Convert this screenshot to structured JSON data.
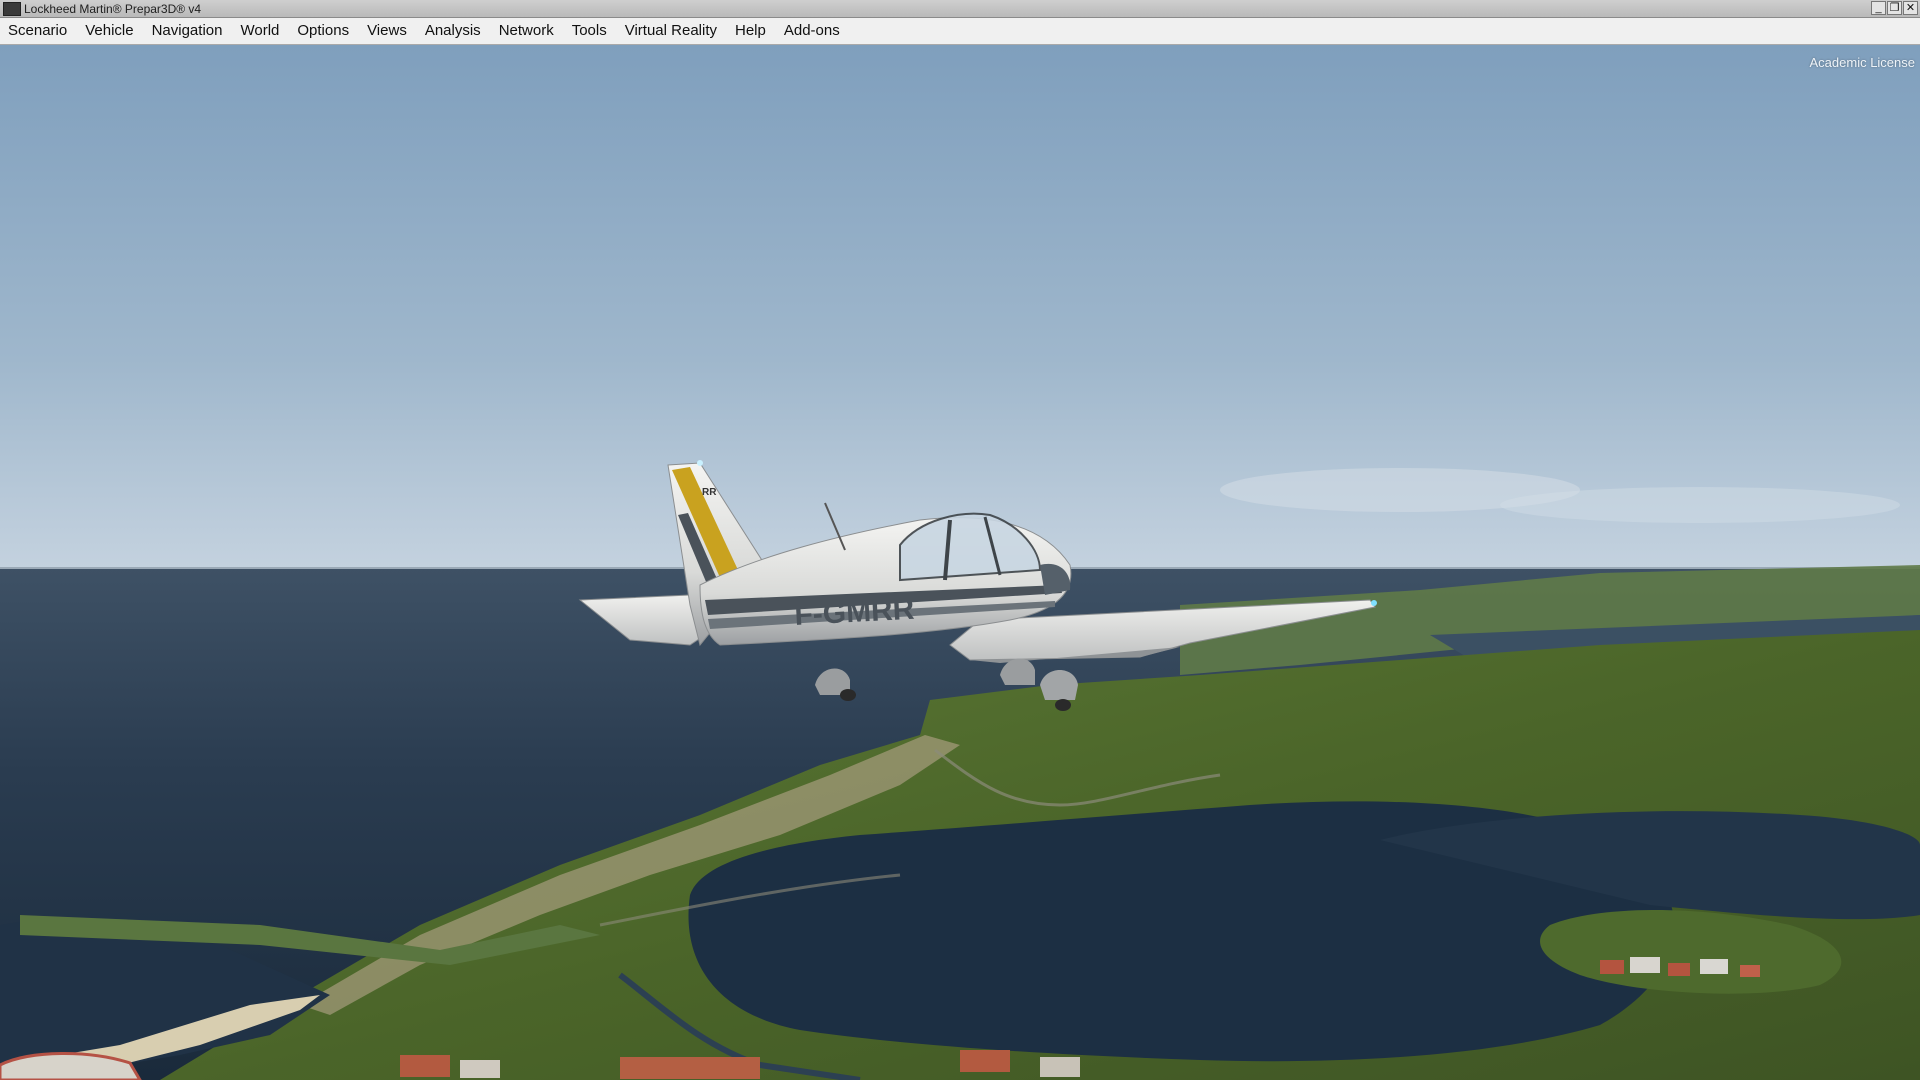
{
  "window": {
    "title": "Lockheed Martin® Prepar3D® v4",
    "controls": [
      "_",
      "❐",
      "✕"
    ]
  },
  "menu": [
    {
      "label": "Scenario"
    },
    {
      "label": "Vehicle"
    },
    {
      "label": "Navigation"
    },
    {
      "label": "World"
    },
    {
      "label": "Options"
    },
    {
      "label": "Views"
    },
    {
      "label": "Analysis"
    },
    {
      "label": "Network"
    },
    {
      "label": "Tools"
    },
    {
      "label": "Virtual Reality"
    },
    {
      "label": "Help"
    },
    {
      "label": "Add-ons"
    }
  ],
  "overlay": {
    "license": "Academic License"
  },
  "aircraft": {
    "registration": "F-GMRR",
    "fin_code": "RR"
  },
  "colors": {
    "sky_top": "#7f9fbd",
    "sky_horizon": "#c4d2df",
    "sea": "#1f3246",
    "land": "#4f6a2e",
    "stripe_yellow": "#c9a21f",
    "stripe_gray": "#4a525a"
  }
}
